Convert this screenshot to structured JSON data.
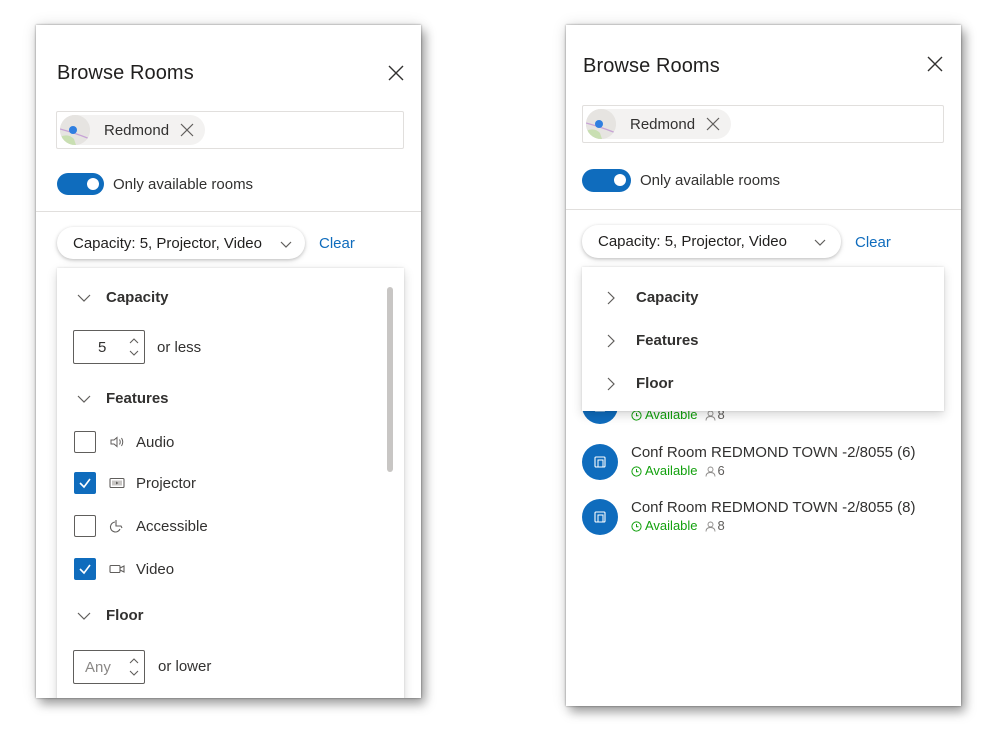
{
  "left_panel": {
    "title": "Browse Rooms",
    "location_chip": {
      "label": "Redmond",
      "icon": "map-icon"
    },
    "toggle": {
      "label": "Only available rooms",
      "on": true
    },
    "filter_pill": {
      "label": "Capacity: 5, Projector, Video"
    },
    "clear_label": "Clear",
    "dropdown": {
      "capacity": {
        "label": "Capacity",
        "expanded": true,
        "value": "5",
        "suffix": "or less"
      },
      "features": {
        "label": "Features",
        "expanded": true,
        "items": [
          {
            "label": "Audio",
            "icon": "speaker-icon",
            "checked": false
          },
          {
            "label": "Projector",
            "icon": "projector-icon",
            "checked": true
          },
          {
            "label": "Accessible",
            "icon": "accessible-icon",
            "checked": false
          },
          {
            "label": "Video",
            "icon": "video-camera-icon",
            "checked": true
          }
        ]
      },
      "floor": {
        "label": "Floor",
        "expanded": true,
        "placeholder": "Any",
        "suffix": "or lower"
      }
    }
  },
  "right_panel": {
    "title": "Browse Rooms",
    "location_chip": {
      "label": "Redmond",
      "icon": "map-icon"
    },
    "toggle": {
      "label": "Only available rooms",
      "on": true
    },
    "filter_pill": {
      "label": "Capacity: 5, Projector, Video"
    },
    "clear_label": "Clear",
    "dropdown": {
      "sections": [
        {
          "label": "Capacity",
          "expanded": false
        },
        {
          "label": "Features",
          "expanded": false
        },
        {
          "label": "Floor",
          "expanded": false
        }
      ]
    },
    "rooms": [
      {
        "name": "",
        "status": "Available",
        "capacity": "8",
        "partially_hidden": true
      },
      {
        "name": "Conf Room REDMOND TOWN -2/8055 (6)",
        "status": "Available",
        "capacity": "6"
      },
      {
        "name": "Conf Room REDMOND TOWN -2/8055 (8)",
        "status": "Available",
        "capacity": "8"
      }
    ]
  },
  "colors": {
    "accent": "#0f6cbd",
    "available": "#13a10e",
    "text": "#323130"
  }
}
